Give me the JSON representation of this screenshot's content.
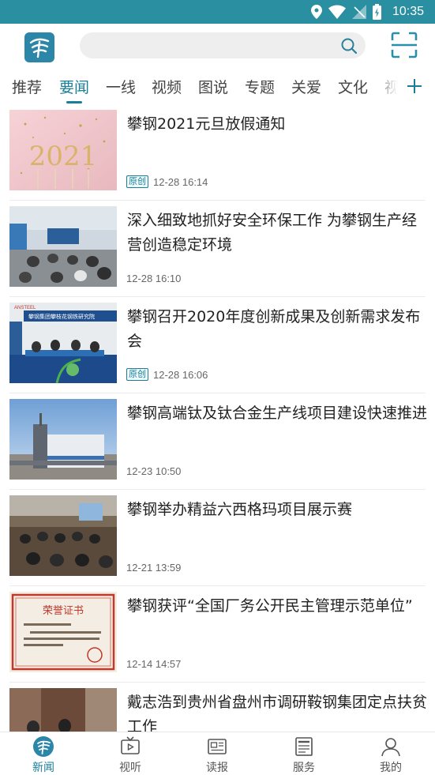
{
  "status_bar": {
    "time": "10:35"
  },
  "header": {
    "logo": "app-logo",
    "search": {
      "value": "",
      "placeholder": ""
    }
  },
  "tabs": [
    {
      "label": "推荐",
      "active": false
    },
    {
      "label": "要闻",
      "active": true
    },
    {
      "label": "一线",
      "active": false
    },
    {
      "label": "视频",
      "active": false
    },
    {
      "label": "图说",
      "active": false
    },
    {
      "label": "专题",
      "active": false
    },
    {
      "label": "关爱",
      "active": false
    },
    {
      "label": "文化",
      "active": false
    },
    {
      "label": "视",
      "active": false
    }
  ],
  "news": [
    {
      "title": "攀钢2021元旦放假通知",
      "badge": "原创",
      "time": "12-28 16:14"
    },
    {
      "title": "深入细致地抓好安全环保工作 为攀钢生产经营创造稳定环境",
      "badge": "",
      "time": "12-28 16:10"
    },
    {
      "title": "攀钢召开2020年度创新成果及创新需求发布会",
      "badge": "原创",
      "time": "12-28 16:06"
    },
    {
      "title": "攀钢高端钛及钛合金生产线项目建设快速推进",
      "badge": "",
      "time": "12-23 10:50"
    },
    {
      "title": "攀钢举办精益六西格玛项目展示赛",
      "badge": "",
      "time": "12-21 13:59"
    },
    {
      "title": "攀钢获评“全国厂务公开民主管理示范单位”",
      "badge": "",
      "time": "12-14 14:57"
    },
    {
      "title": "戴志浩到贵州省盘州市调研鞍钢集团定点扶贫工作",
      "badge": "",
      "time": ""
    }
  ],
  "thumb_text": {
    "year": "2021",
    "banner": "攀钢集团攀枝花钢铁研究院",
    "ansteel": "ANSTEEL",
    "certificate": "荣誉证书"
  },
  "bottom_nav": [
    {
      "label": "新闻",
      "icon": "news-logo-icon",
      "active": true
    },
    {
      "label": "视听",
      "icon": "tv-icon",
      "active": false
    },
    {
      "label": "读报",
      "icon": "newspaper-icon",
      "active": false
    },
    {
      "label": "服务",
      "icon": "service-news-icon",
      "active": false
    },
    {
      "label": "我的",
      "icon": "user-icon",
      "active": false
    }
  ],
  "colors": {
    "status_bar": "#2a8fa0",
    "accent": "#1a7e98",
    "logo": "#2c86a8"
  }
}
